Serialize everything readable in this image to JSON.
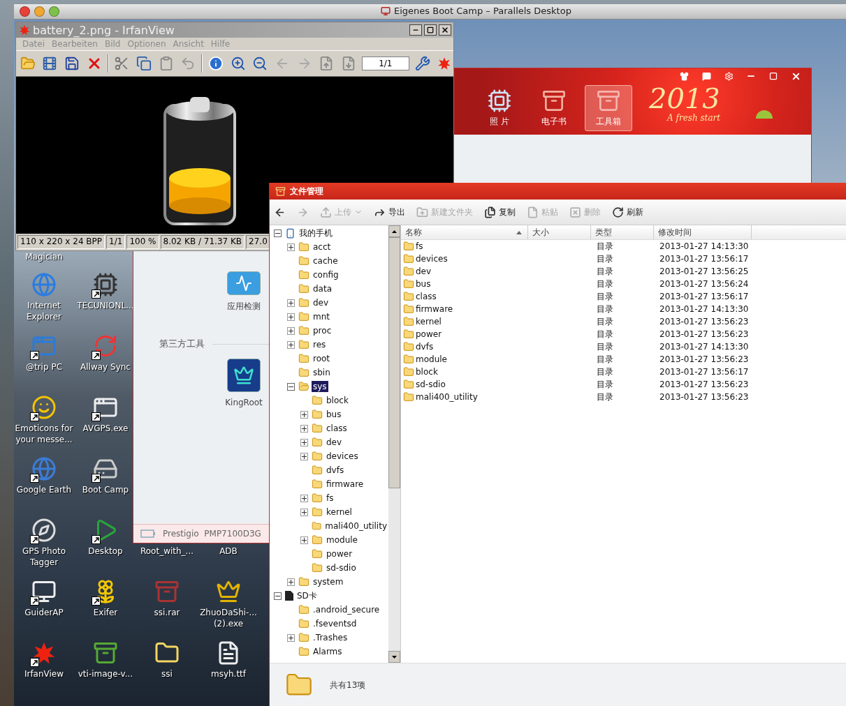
{
  "host_window": {
    "title": "Eigenes Boot Camp – Parallels Desktop"
  },
  "irfanview": {
    "title": "battery_2.png - IrfanView",
    "menu": [
      "Datei",
      "Bearbeiten",
      "Bild",
      "Optionen",
      "Ansicht",
      "Hilfe"
    ],
    "page_field": {
      "value": "1/1"
    },
    "status_bar": [
      "110 x 220 x 24 BPP",
      "1/1",
      "100 %",
      "8.02 KB / 71.37 KB",
      "27.0"
    ]
  },
  "phone_assistant": {
    "tabs": [
      {
        "label": "照 片",
        "selected": false
      },
      {
        "label": "电子书",
        "selected": false
      },
      {
        "label": "工具箱",
        "selected": true
      }
    ],
    "banner": {
      "year": "2013",
      "slogan": "A fresh start"
    },
    "tools": [
      {
        "label": "应用检测"
      }
    ],
    "section_title": "第三方工具",
    "third_party_tools": [
      {
        "label": "KingRoot"
      }
    ],
    "status_bar": {
      "device": "Prestigio  PMP7100D3G"
    }
  },
  "desktop_icons": [
    {
      "icons": [
        {
          "label": "Magician",
          "icon_visible": false
        }
      ]
    },
    {
      "icons": [
        {
          "label": "Internet Explorer",
          "icon_visible": true,
          "shortcut": false
        },
        {
          "label": "TECUNIONL...",
          "icon_visible": true,
          "shortcut": true
        }
      ]
    },
    {
      "icons": [
        {
          "label": "@trip PC",
          "icon_visible": true,
          "shortcut": true
        },
        {
          "label": "Allway Sync",
          "icon_visible": true,
          "shortcut": true
        }
      ]
    },
    {
      "icons": [
        {
          "label": "Emoticons for your messe...",
          "icon_visible": true,
          "shortcut": true
        },
        {
          "label": "AVGPS.exe",
          "icon_visible": true,
          "shortcut": true
        }
      ]
    },
    {
      "icons": [
        {
          "label": "Google Earth",
          "icon_visible": true,
          "shortcut": true
        },
        {
          "label": "Boot Camp",
          "icon_visible": true,
          "shortcut": true
        }
      ]
    },
    {
      "icons": [
        {
          "label": "GPS Photo Tagger",
          "icon_visible": true,
          "shortcut": true
        },
        {
          "label": "Desktop",
          "icon_visible": true,
          "shortcut": true
        },
        {
          "label": "Root_with_...",
          "icon_visible": false
        },
        {
          "label": "ADB",
          "icon_visible": false
        }
      ]
    },
    {
      "icons": [
        {
          "label": "GuiderAP",
          "icon_visible": true,
          "shortcut": true
        },
        {
          "label": "Exifer",
          "icon_visible": true,
          "shortcut": true
        },
        {
          "label": "ssi.rar",
          "icon_visible": true,
          "shortcut": false
        },
        {
          "label": "ZhuoDaShi-...(2).exe",
          "icon_visible": true,
          "shortcut": false
        }
      ]
    },
    {
      "icons": [
        {
          "label": "IrfanView",
          "icon_visible": true,
          "shortcut": true
        },
        {
          "label": "vti-image-v...",
          "icon_visible": true,
          "shortcut": false
        },
        {
          "label": "ssi",
          "icon_visible": true,
          "shortcut": false
        },
        {
          "label": "msyh.ttf",
          "icon_visible": true,
          "shortcut": false
        }
      ]
    }
  ],
  "file_manager": {
    "title": "文件管理",
    "toolbar": [
      {
        "kind": "back",
        "disabled": false
      },
      {
        "kind": "forward",
        "disabled": true
      },
      {
        "kind": "upload",
        "label": "上传",
        "disabled": true
      },
      {
        "kind": "export",
        "label": "导出",
        "disabled": false
      },
      {
        "kind": "new_folder",
        "label": "新建文件夹",
        "disabled": true
      },
      {
        "kind": "copy",
        "label": "复制",
        "disabled": false
      },
      {
        "kind": "paste",
        "label": "粘贴",
        "disabled": true
      },
      {
        "kind": "delete",
        "label": "删除",
        "disabled": true
      },
      {
        "kind": "refresh",
        "label": "刷新",
        "disabled": false
      }
    ],
    "tree": [
      {
        "label": "我的手机",
        "kind": "phone",
        "expandable": true,
        "expanded": true,
        "selected": false,
        "children": [
          {
            "label": "acct",
            "kind": "folder",
            "expandable": true,
            "expanded": false,
            "selected": false
          },
          {
            "label": "cache",
            "kind": "folder",
            "expandable": false,
            "selected": false
          },
          {
            "label": "config",
            "kind": "folder",
            "expandable": false,
            "selected": false
          },
          {
            "label": "data",
            "kind": "folder",
            "expandable": false,
            "selected": false
          },
          {
            "label": "dev",
            "kind": "folder",
            "expandable": true,
            "expanded": false,
            "selected": false
          },
          {
            "label": "mnt",
            "kind": "folder",
            "expandable": true,
            "expanded": false,
            "selected": false
          },
          {
            "label": "proc",
            "kind": "folder",
            "expandable": true,
            "expanded": false,
            "selected": false
          },
          {
            "label": "res",
            "kind": "folder",
            "expandable": true,
            "expanded": false,
            "selected": false
          },
          {
            "label": "root",
            "kind": "folder",
            "expandable": false,
            "selected": false
          },
          {
            "label": "sbin",
            "kind": "folder",
            "expandable": false,
            "selected": false
          },
          {
            "label": "sys",
            "kind": "folder",
            "expandable": true,
            "expanded": true,
            "selected": true,
            "children": [
              {
                "label": "block",
                "kind": "folder",
                "expandable": false,
                "selected": false
              },
              {
                "label": "bus",
                "kind": "folder",
                "expandable": true,
                "expanded": false,
                "selected": false
              },
              {
                "label": "class",
                "kind": "folder",
                "expandable": true,
                "expanded": false,
                "selected": false
              },
              {
                "label": "dev",
                "kind": "folder",
                "expandable": true,
                "expanded": false,
                "selected": false
              },
              {
                "label": "devices",
                "kind": "folder",
                "expandable": true,
                "expanded": false,
                "selected": false
              },
              {
                "label": "dvfs",
                "kind": "folder",
                "expandable": false,
                "selected": false
              },
              {
                "label": "firmware",
                "kind": "folder",
                "expandable": false,
                "selected": false
              },
              {
                "label": "fs",
                "kind": "folder",
                "expandable": true,
                "expanded": false,
                "selected": false
              },
              {
                "label": "kernel",
                "kind": "folder",
                "expandable": true,
                "expanded": false,
                "selected": false
              },
              {
                "label": "mali400_utility",
                "kind": "folder",
                "expandable": false,
                "selected": false
              },
              {
                "label": "module",
                "kind": "folder",
                "expandable": true,
                "expanded": false,
                "selected": false
              },
              {
                "label": "power",
                "kind": "folder",
                "expandable": false,
                "selected": false
              },
              {
                "label": "sd-sdio",
                "kind": "folder",
                "expandable": false,
                "selected": false
              }
            ]
          },
          {
            "label": "system",
            "kind": "folder",
            "expandable": true,
            "expanded": false,
            "selected": false
          }
        ]
      },
      {
        "label": "SD卡",
        "kind": "sdcard",
        "expandable": true,
        "expanded": true,
        "selected": false,
        "children": [
          {
            "label": ".android_secure",
            "kind": "folder",
            "expandable": false,
            "selected": false
          },
          {
            "label": ".fseventsd",
            "kind": "folder",
            "expandable": false,
            "selected": false
          },
          {
            "label": ".Trashes",
            "kind": "folder",
            "expandable": true,
            "expanded": false,
            "selected": false
          },
          {
            "label": "Alarms",
            "kind": "folder",
            "expandable": false,
            "selected": false
          }
        ]
      }
    ],
    "table": {
      "columns": [
        {
          "label": "名称",
          "sorted": true
        },
        {
          "label": "大小",
          "sorted": false
        },
        {
          "label": "类型",
          "sorted": false
        },
        {
          "label": "修改时间",
          "sorted": false
        }
      ],
      "rows": [
        {
          "name": "fs",
          "type": "目录",
          "modified": "2013-01-27 14:13:30"
        },
        {
          "name": "devices",
          "type": "目录",
          "modified": "2013-01-27 13:56:17"
        },
        {
          "name": "dev",
          "type": "目录",
          "modified": "2013-01-27 13:56:25"
        },
        {
          "name": "bus",
          "type": "目录",
          "modified": "2013-01-27 13:56:24"
        },
        {
          "name": "class",
          "type": "目录",
          "modified": "2013-01-27 13:56:17"
        },
        {
          "name": "firmware",
          "type": "目录",
          "modified": "2013-01-27 14:13:30"
        },
        {
          "name": "kernel",
          "type": "目录",
          "modified": "2013-01-27 13:56:23"
        },
        {
          "name": "power",
          "type": "目录",
          "modified": "2013-01-27 13:56:23"
        },
        {
          "name": "dvfs",
          "type": "目录",
          "modified": "2013-01-27 14:13:30"
        },
        {
          "name": "module",
          "type": "目录",
          "modified": "2013-01-27 13:56:23"
        },
        {
          "name": "block",
          "type": "目录",
          "modified": "2013-01-27 13:56:17"
        },
        {
          "name": "sd-sdio",
          "type": "目录",
          "modified": "2013-01-27 13:56:23"
        },
        {
          "name": "mali400_utility",
          "type": "目录",
          "modified": "2013-01-27 13:56:23"
        }
      ]
    },
    "footer": {
      "count": "共有13项"
    }
  }
}
